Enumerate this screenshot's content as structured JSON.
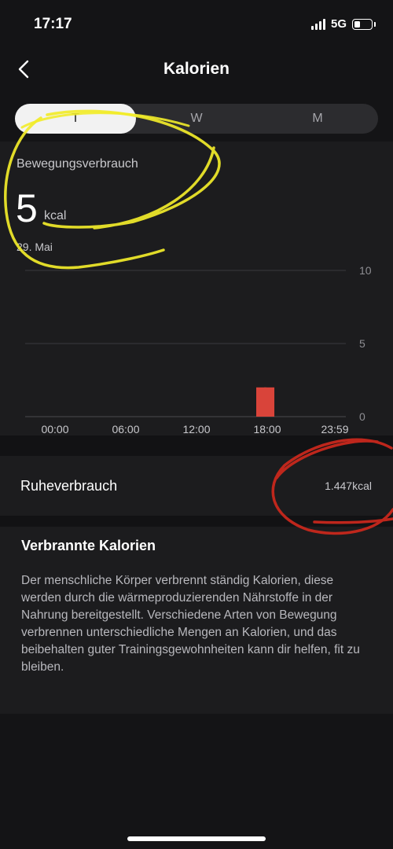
{
  "status_bar": {
    "time": "17:17",
    "network": "5G",
    "battery_level": 0.35
  },
  "header": {
    "title": "Kalorien"
  },
  "tabs": [
    {
      "label": "T",
      "active": true
    },
    {
      "label": "W",
      "active": false
    },
    {
      "label": "M",
      "active": false
    }
  ],
  "summary": {
    "label": "Bewegungsverbrauch",
    "value": "5",
    "unit": "kcal",
    "date": "29. Mai"
  },
  "chart_data": {
    "type": "bar",
    "x_tick_labels": [
      "00:00",
      "06:00",
      "12:00",
      "18:00",
      "23:59"
    ],
    "y_tick_labels": [
      "10",
      "5",
      "0"
    ],
    "ylim": [
      0,
      10
    ],
    "x_range_hours": [
      0,
      24
    ],
    "bars": [
      {
        "hour": 17.5,
        "value": 2
      },
      {
        "hour": 17.83,
        "value": 1
      },
      {
        "hour": 18.17,
        "value": 2
      }
    ],
    "bar_color": "#d9443a",
    "grid": true
  },
  "rest": {
    "label": "Ruheverbrauch",
    "value": "1.447kcal"
  },
  "info": {
    "title": "Verbrannte Kalorien",
    "text": "Der menschliche Körper verbrennt ständig Kalorien, diese werden durch die wärmeproduzierenden Nährstoffe in der Nahrung bereitgestellt. Verschiedene Arten von Bewegung verbrennen unterschiedliche Mengen an Kalorien, und das beibehalten guter Trainingsgewohnheiten kann dir helfen, fit zu bleiben."
  },
  "colors": {
    "background": "#141416",
    "card": "#1c1c1e",
    "accent_bar": "#d9443a",
    "annotation_yellow": "#f2ec2a",
    "annotation_red": "#c8281c"
  }
}
